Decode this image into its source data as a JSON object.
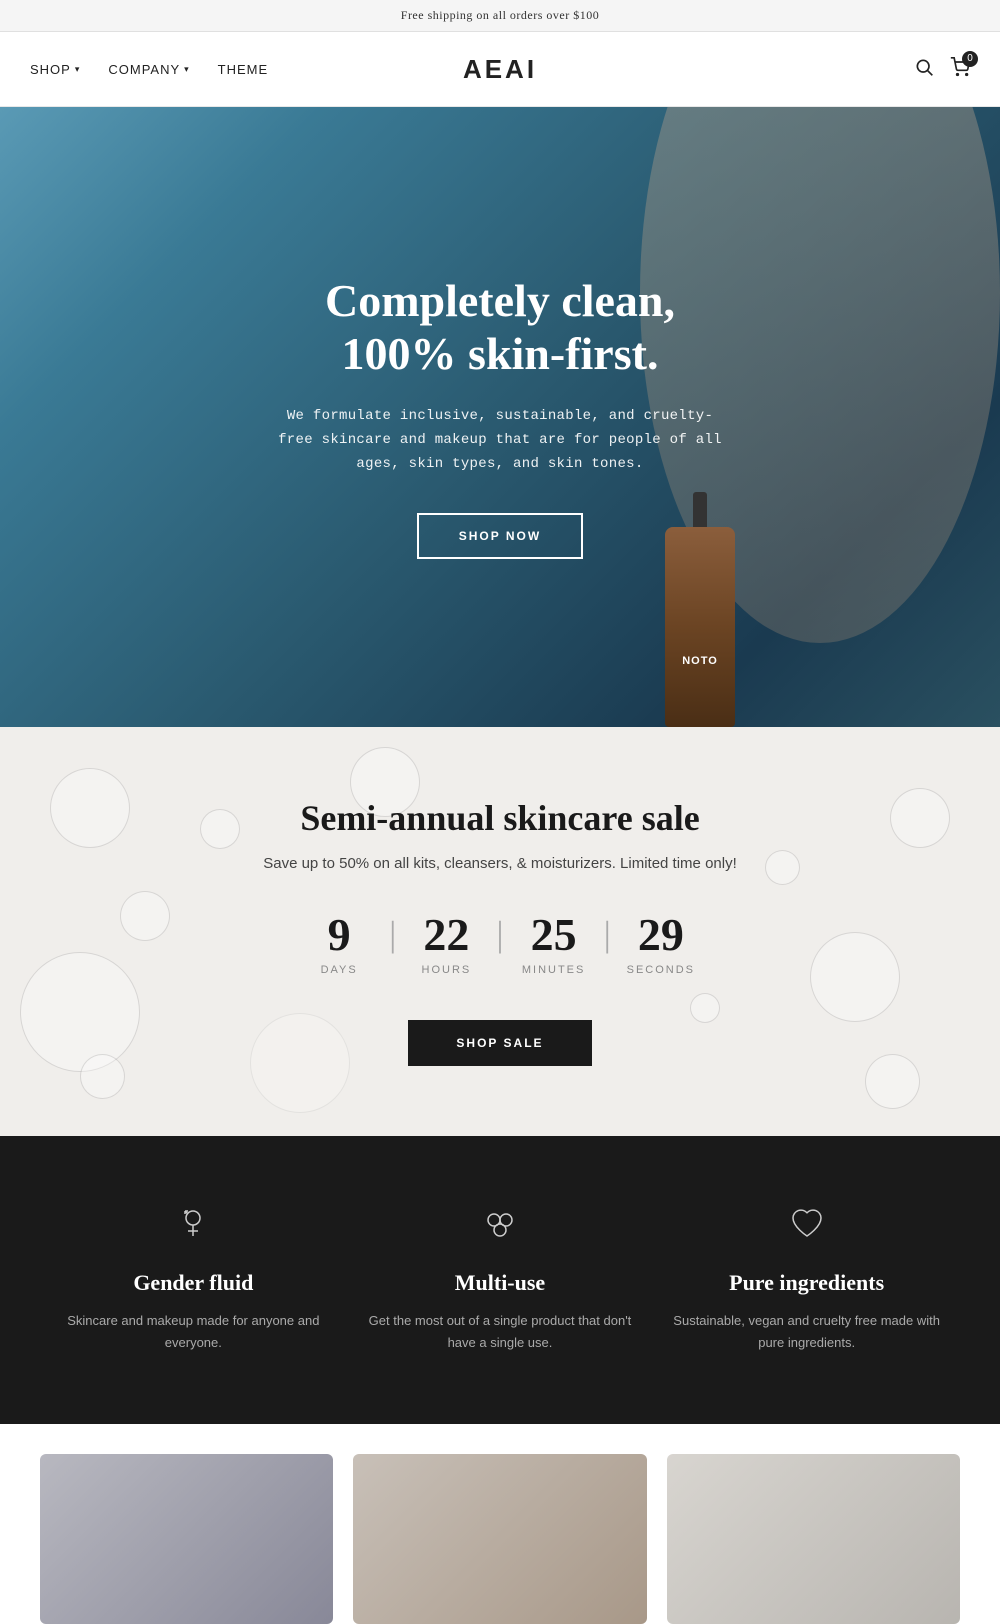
{
  "announcement": {
    "text": "Free shipping on all orders over $100"
  },
  "nav": {
    "shop_label": "SHOP",
    "company_label": "COMPANY",
    "theme_label": "THEME",
    "logo": "AEAI",
    "cart_count": "0"
  },
  "hero": {
    "title": "Completely clean, 100% skin-first.",
    "subtitle": "We formulate inclusive, sustainable, and cruelty-free skincare and makeup that are for people of all ages, skin types, and skin tones.",
    "cta_label": "SHOP NOW",
    "bottle_text": "NOTO"
  },
  "sale": {
    "title": "Semi-annual skincare sale",
    "subtitle": "Save up to 50% on all kits, cleansers, & moisturizers. Limited time only!",
    "countdown": {
      "days": "9",
      "hours": "22",
      "minutes": "25",
      "seconds": "29",
      "days_label": "DAYS",
      "hours_label": "HOURS",
      "minutes_label": "MINUTES",
      "seconds_label": "SECONDS"
    },
    "cta_label": "SHOP SALE"
  },
  "features": [
    {
      "icon": "♀",
      "title": "Gender fluid",
      "description": "Skincare and makeup made for anyone and everyone."
    },
    {
      "icon": "⊕",
      "title": "Multi-use",
      "description": "Get the most out of a single product that don't have a single use."
    },
    {
      "icon": "♡",
      "title": "Pure ingredients",
      "description": "Sustainable, vegan and cruelty free made with pure ingredients."
    }
  ]
}
